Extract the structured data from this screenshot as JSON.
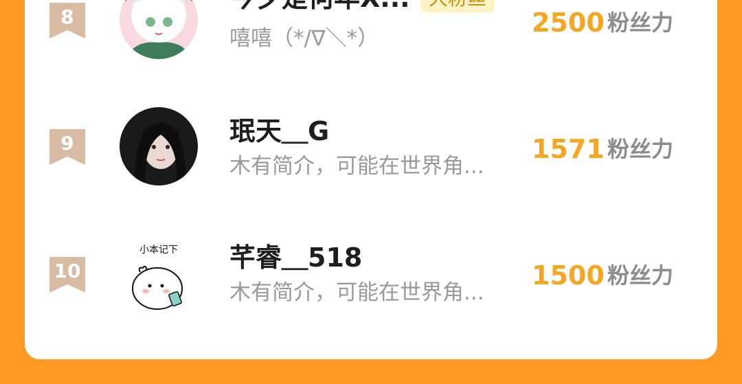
{
  "colors": {
    "accent": "#F5A623",
    "frame": "#FF9A24",
    "rank_badge": "#D7BBA3"
  },
  "leaderboard": {
    "rows": [
      {
        "rank": "8",
        "name": "今夕是何年X...",
        "badge": "大粉丝",
        "bio": "嘻嘻（*/∇＼*）",
        "score": "2500",
        "score_label": "粉丝力",
        "avatar": "anime-boy-avatar"
      },
      {
        "rank": "9",
        "name": "珉天＿G",
        "bio": "木有简介，可能在世界角...",
        "score": "1571",
        "score_label": "粉丝力",
        "avatar": "girl-photo-avatar"
      },
      {
        "rank": "10",
        "name": "芊睿＿518",
        "bio": "木有简介，可能在世界角...",
        "score": "1500",
        "score_label": "粉丝力",
        "avatar": "cartoon-bun-avatar",
        "avatar_caption": "小本记下"
      }
    ]
  }
}
